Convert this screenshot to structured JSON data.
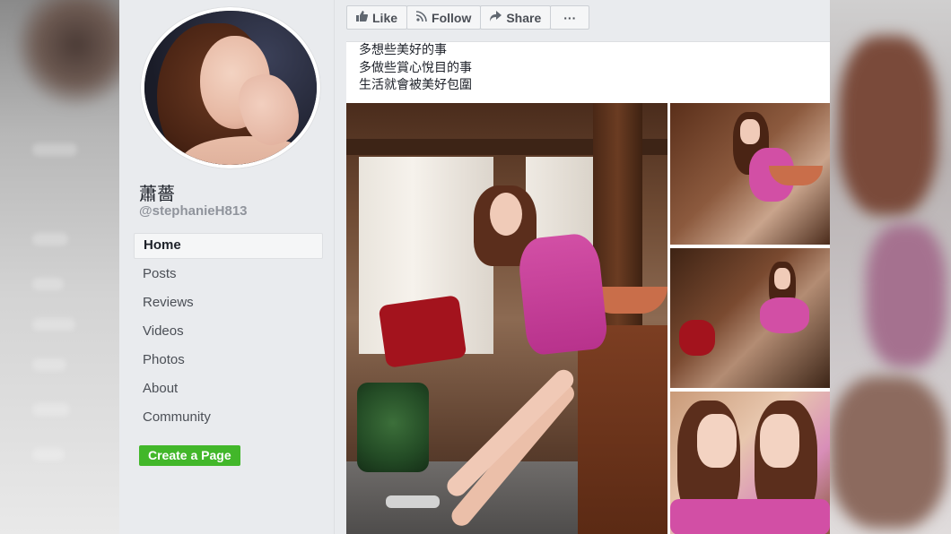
{
  "page": {
    "name": "蕭薔",
    "handle": "@stephanieH813"
  },
  "nav": {
    "items": [
      {
        "label": "Home",
        "active": true
      },
      {
        "label": "Posts",
        "active": false
      },
      {
        "label": "Reviews",
        "active": false
      },
      {
        "label": "Videos",
        "active": false
      },
      {
        "label": "Photos",
        "active": false
      },
      {
        "label": "About",
        "active": false
      },
      {
        "label": "Community",
        "active": false
      }
    ]
  },
  "create_page_label": "Create a Page",
  "actions": {
    "like": "Like",
    "follow": "Follow",
    "share": "Share",
    "more": "···"
  },
  "post": {
    "lines": [
      "多想些美好的事",
      "多做些賞心悅目的事",
      "生活就會被美好包圍"
    ]
  },
  "colors": {
    "accent_green": "#42b72a",
    "fb_bg": "#e9ebee",
    "dress_pink": "#d24fa5"
  },
  "icons": {
    "like": "thumbs-up-icon",
    "follow": "rss-icon",
    "share": "share-arrow-icon",
    "more": "more-dots-icon"
  }
}
